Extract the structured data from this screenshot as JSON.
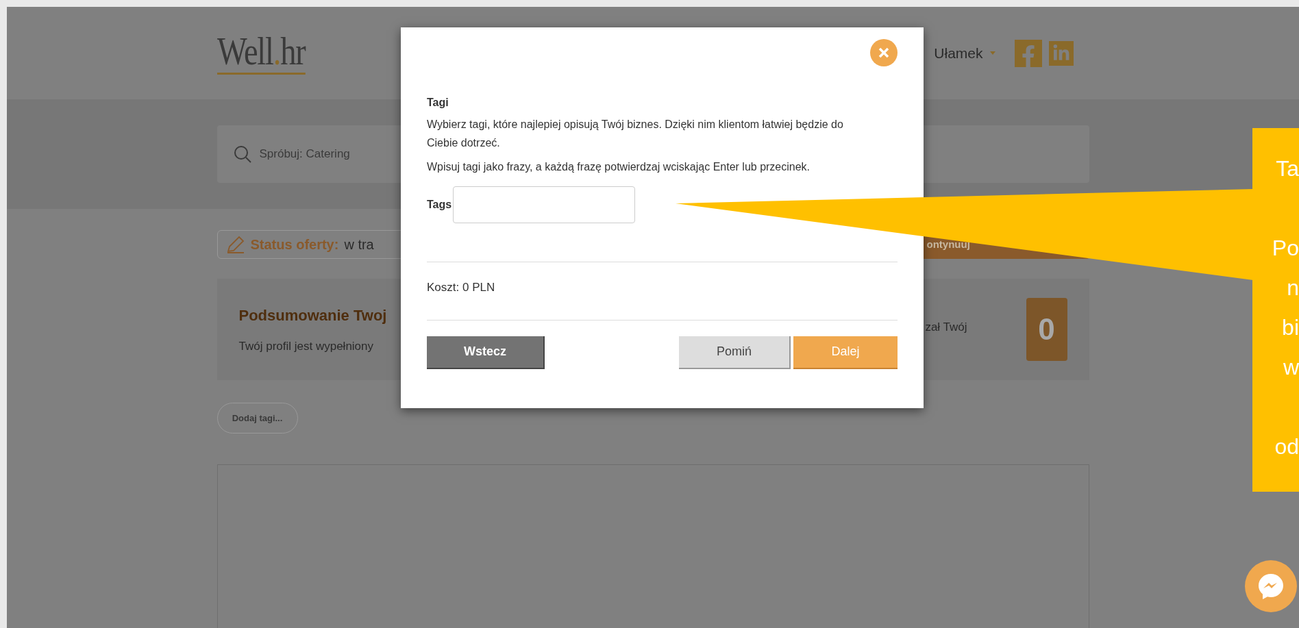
{
  "header": {
    "logo": [
      "Well",
      ".",
      "hr"
    ],
    "user_menu": "Ułamek"
  },
  "search": {
    "placeholder": "Spróbuj: Catering"
  },
  "status": {
    "label": "Status oferty:",
    "value": "w tra",
    "action": "ontynuuj"
  },
  "summary": {
    "title": "Podsumowanie Twoj",
    "text": "Twój profil jest wypełniony",
    "text_right": "zał Twój",
    "score": "0"
  },
  "add_tags": "Dodaj tagi...",
  "modal": {
    "title": "Tagi",
    "description": "Wybierz tagi, które najlepiej opisują Twój biznes. Dzięki nim klientom łatwiej będzie do Ciebie dotrzeć.",
    "hint": "Wpisuj tagi jako frazy, a każdą frazę potwierdzaj wciskając Enter lub przecinek.",
    "field_label": "Tags",
    "cost": "Koszt: 0 PLN",
    "buttons": [
      {
        "kind": "back",
        "label": "Wstecz"
      },
      {
        "kind": "skip",
        "label": "Pomiń"
      },
      {
        "kind": "next",
        "label": "Dalej"
      }
    ]
  },
  "callout": {
    "paragraphs": [
      [
        "Ta"
      ],
      [
        "Po",
        "n",
        "bi",
        "w"
      ],
      [
        "od"
      ]
    ]
  }
}
